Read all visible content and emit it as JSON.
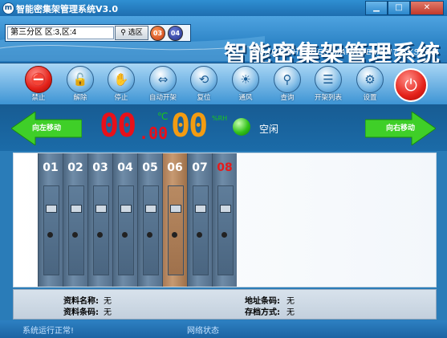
{
  "window": {
    "title": "智能密集架管理系统V3.0",
    "min": "▁",
    "max": "□",
    "close": "✕"
  },
  "header": {
    "area_value": "第三分区 区:3,区:4",
    "select_label": "选区",
    "num_a": "03",
    "num_b": "04",
    "brand_cn": "智能密集架管理系统",
    "brand_en": "SMART SHELUES MANAGEMENT SYSTEM"
  },
  "toolbar": [
    {
      "label": "禁止",
      "icon": "no-entry-icon",
      "glyph": "⛔"
    },
    {
      "label": "解除",
      "icon": "unlock-icon",
      "glyph": "🔓"
    },
    {
      "label": "停止",
      "icon": "stop-icon",
      "glyph": "✋"
    },
    {
      "label": "自动开架",
      "icon": "arrows-icon",
      "glyph": "⇔"
    },
    {
      "label": "复位",
      "icon": "reset-icon",
      "glyph": "⟲"
    },
    {
      "label": "通风",
      "icon": "sun-icon",
      "glyph": "☀"
    },
    {
      "label": "查询",
      "icon": "search-person-icon",
      "glyph": "⚲"
    },
    {
      "label": "开架列表",
      "icon": "list-icon",
      "glyph": "☰"
    },
    {
      "label": "设置",
      "icon": "wrench-icon",
      "glyph": "⚙"
    },
    {
      "label": "",
      "icon": "power-icon",
      "glyph": "⏻"
    }
  ],
  "infobar": {
    "left_arrow": "向左移动",
    "right_arrow": "向右移动",
    "temp": "00",
    "temp_dec": ".00",
    "temp_unit": "℃",
    "humidity": "00",
    "humidity_unit": "%RH",
    "status": "空闲"
  },
  "shelves": [
    {
      "num": "01",
      "open": false,
      "color": "#ffffff"
    },
    {
      "num": "02",
      "open": false,
      "color": "#ffffff"
    },
    {
      "num": "03",
      "open": false,
      "color": "#ffffff"
    },
    {
      "num": "04",
      "open": false,
      "color": "#ffffff"
    },
    {
      "num": "05",
      "open": false,
      "color": "#ffffff"
    },
    {
      "num": "06",
      "open": true,
      "color": "#ffffff"
    },
    {
      "num": "07",
      "open": false,
      "color": "#ffffff"
    },
    {
      "num": "08",
      "open": false,
      "color": "#e41b1b"
    }
  ],
  "detail": {
    "name_label": "资料名称:",
    "name_value": "无",
    "code_label": "资料条码:",
    "code_value": "无",
    "addr_label": "地址条码:",
    "addr_value": "无",
    "mode_label": "存档方式:",
    "mode_value": "无"
  },
  "statusbar": {
    "left": "系统运行正常!",
    "mid": "网络状态"
  }
}
